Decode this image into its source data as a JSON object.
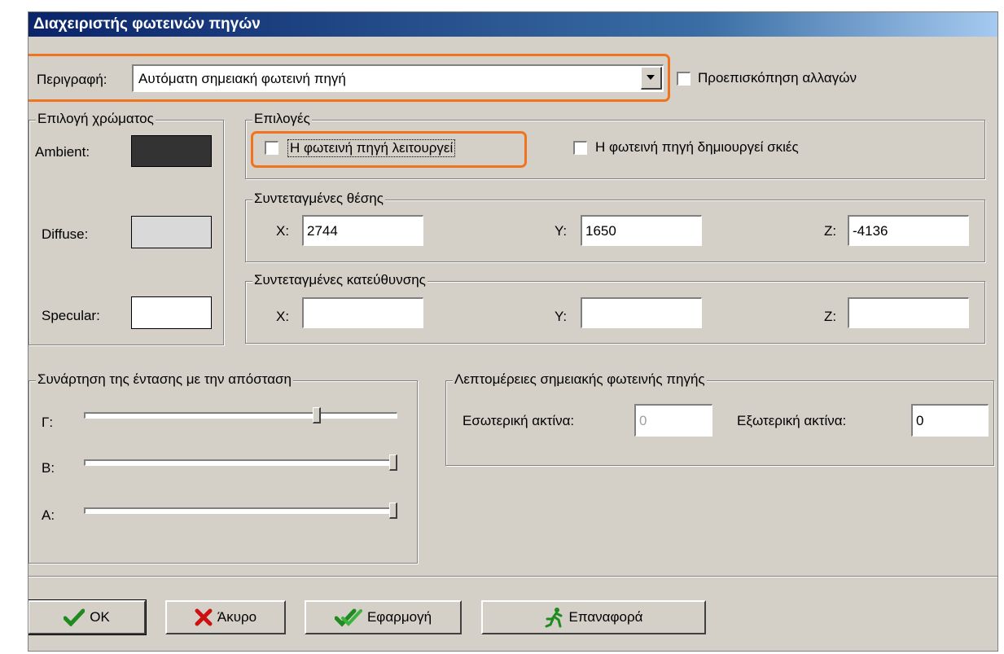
{
  "window": {
    "title": "Διαχειριστής φωτεινών πηγών"
  },
  "description": {
    "label": "Περιγραφή:",
    "value": "Αυτόματη σημειακή φωτεινή πηγή"
  },
  "preview": {
    "label": "Προεπισκόπηση αλλαγών",
    "checked": false
  },
  "color_group": {
    "title": "Επιλογή χρώματος",
    "ambient_label": "Ambient:",
    "ambient_color": "#333333",
    "diffuse_label": "Diffuse:",
    "diffuse_color": "#d9d9d9",
    "specular_label": "Specular:",
    "specular_color": "#ffffff"
  },
  "options_group": {
    "title": "Επιλογές",
    "light_on_label": "Η φωτεινή πηγή λειτουργεί",
    "shadows_label": "Η φωτεινή πηγή δημιουργεί σκιές"
  },
  "position_group": {
    "title": "Συντεταγμένες θέσης",
    "x_label": "X:",
    "x_value": "2744",
    "y_label": "Y:",
    "y_value": "1650",
    "z_label": "Z:",
    "z_value": "-4136"
  },
  "direction_group": {
    "title": "Συντεταγμένες κατεύθυνσης",
    "x_label": "X:",
    "x_value": "",
    "y_label": "Y:",
    "y_value": "",
    "z_label": "Z:",
    "z_value": ""
  },
  "attenuation_group": {
    "title": "Συνάρτηση της έντασης με την απόσταση",
    "g_label": "Γ:",
    "g_level": 0.75,
    "b_label": "B:",
    "b_level": 1.0,
    "a_label": "A:",
    "a_level": 1.0
  },
  "spot_group": {
    "title": "Λεπτομέρειες σημειακής φωτεινής πηγής",
    "inner_label": "Εσωτερική ακτίνα:",
    "inner_value": "0",
    "outer_label": "Εξωτερική ακτίνα:",
    "outer_value": "0"
  },
  "buttons": {
    "ok": "OK",
    "cancel": "Άκυρο",
    "apply": "Εφαρμογή",
    "reset": "Επαναφορά"
  },
  "colors": {
    "highlight": "#f0741f",
    "titlebar": "#0a246a"
  }
}
